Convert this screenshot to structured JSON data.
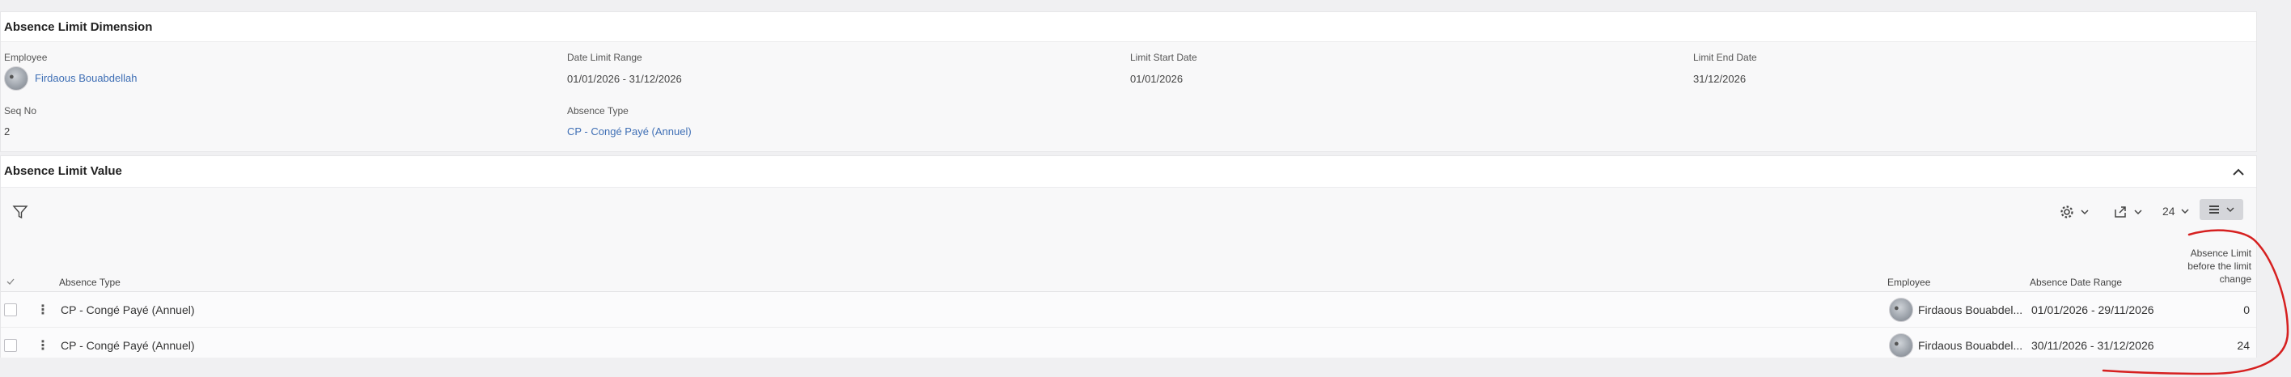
{
  "dimension": {
    "title": "Absence Limit Dimension",
    "employee_label": "Employee",
    "employee_value": "Firdaous Bouabdellah",
    "date_range_label": "Date Limit Range",
    "date_range_value": "01/01/2026 - 31/12/2026",
    "start_label": "Limit Start Date",
    "start_value": "01/01/2026",
    "end_label": "Limit End Date",
    "end_value": "31/12/2026",
    "seq_label": "Seq No",
    "seq_value": "2",
    "type_label": "Absence Type",
    "type_value": "CP - Congé Payé (Annuel)"
  },
  "values": {
    "title": "Absence Limit Value",
    "toolbar": {
      "filter_icon": "filter-icon",
      "settings_icon": "gear-icon",
      "export_icon": "export-icon",
      "page_size": "24",
      "view_icon": "list-view-icon"
    },
    "columns": {
      "absence_type": "Absence Type",
      "employee": "Employee",
      "date_range": "Absence Date Range",
      "before_change": [
        "Absence Limit",
        "before the limit",
        "change"
      ]
    },
    "rows": [
      {
        "absence_type": "CP - Congé Payé (Annuel)",
        "employee": "Firdaous Bouabdel...",
        "date_range": "01/01/2026 - 29/11/2026",
        "before_change": "0"
      },
      {
        "absence_type": "CP - Congé Payé (Annuel)",
        "employee": "Firdaous Bouabdel...",
        "date_range": "30/11/2026 - 31/12/2026",
        "before_change": "24"
      }
    ]
  },
  "colors": {
    "link": "#3f6fb5",
    "annotation": "#d62020",
    "background": "#f0f0f2",
    "card": "#ffffff"
  }
}
